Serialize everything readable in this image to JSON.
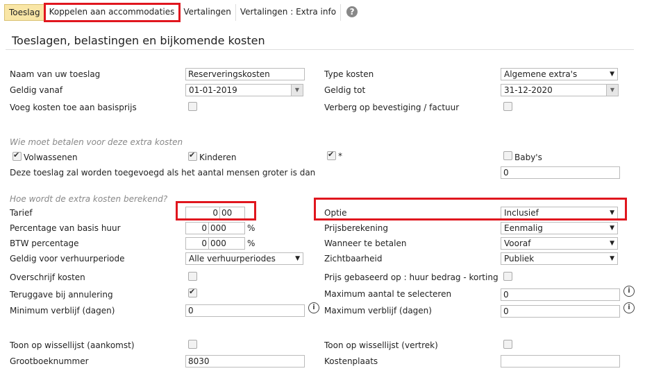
{
  "tabs": [
    "Toeslag",
    "Koppelen aan accommodaties",
    "Vertalingen",
    "Vertalingen : Extra info"
  ],
  "help_icon": "?",
  "title": "Toeslagen, belastingen en bijkomende kosten",
  "naam_label": "Naam van uw toeslag",
  "naam_value": "Reserveringskosten",
  "type_label": "Type kosten",
  "type_value": "Algemene extra's",
  "geldig_vanaf_label": "Geldig vanaf",
  "geldig_vanaf_value": "01-01-2019",
  "geldig_tot_label": "Geldig tot",
  "geldig_tot_value": "31-12-2020",
  "basisprijs_label": "Voeg kosten toe aan basisprijs",
  "verberg_label": "Verberg op bevestiging / factuur",
  "wie_section": "Wie moet betalen voor deze extra kosten",
  "volwassenen": "Volwassenen",
  "kinderen": "Kinderen",
  "star": "*",
  "babys": "Baby's",
  "toeslag_mensen_label": "Deze toeslag zal worden toegevoegd als het aantal mensen groter is dan",
  "toeslag_mensen_value": "0",
  "hoe_section": "Hoe wordt de extra kosten berekend?",
  "tarief_label": "Tarief",
  "tarief_int": "0",
  "tarief_dec": "00",
  "optie_label": "Optie",
  "optie_value": "Inclusief",
  "percentage_label": "Percentage van basis huur",
  "percentage_int": "0",
  "percentage_dec": "000",
  "percent_sign": "%",
  "prijsberekening_label": "Prijsberekening",
  "prijsberekening_value": "Eenmalig",
  "btw_label": "BTW percentage",
  "btw_int": "0",
  "btw_dec": "000",
  "wanneer_label": "Wanneer te betalen",
  "wanneer_value": "Vooraf",
  "periode_label": "Geldig voor verhuurperiode",
  "periode_value": "Alle verhuurperiodes",
  "zicht_label": "Zichtbaarheid",
  "zicht_value": "Publiek",
  "overschrijf_label": "Overschrijf kosten",
  "prijs_gebaseerd_label": "Prijs gebaseerd op : huur bedrag - korting",
  "teruggave_label": "Teruggave bij annulering",
  "max_aantal_label": "Maximum aantal te selecteren",
  "max_aantal_value": "0",
  "min_verblijf_label": "Minimum verblijf (dagen)",
  "min_verblijf_value": "0",
  "max_verblijf_label": "Maximum verblijf (dagen)",
  "max_verblijf_value": "0",
  "toon_aankomst_label": "Toon op wissellijst (aankomst)",
  "toon_vertrek_label": "Toon op wissellijst (vertrek)",
  "grootboek_label": "Grootboeknummer",
  "grootboek_value": "8030",
  "kostenplaats_label": "Kostenplaats",
  "kostenplaats_value": "",
  "dropdown_arrow": "▼",
  "date_arrow": "▼",
  "info_glyph": "i"
}
